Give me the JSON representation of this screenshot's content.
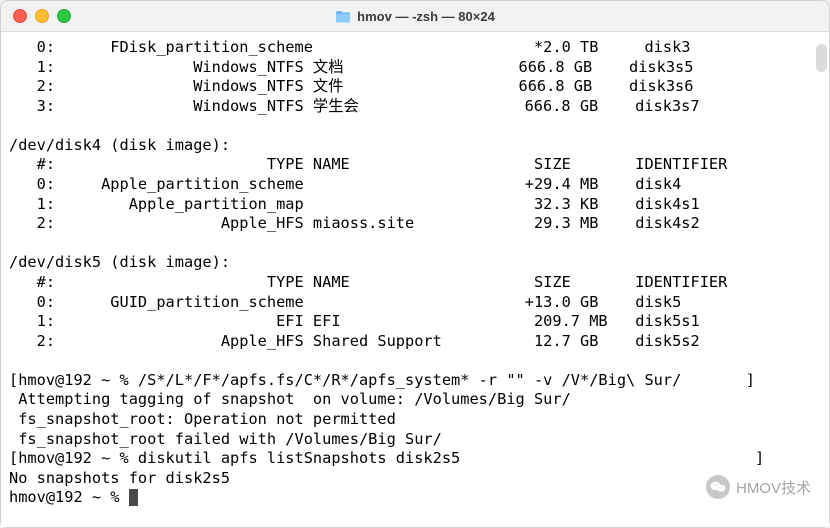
{
  "window": {
    "title": "hmov — -zsh — 80×24"
  },
  "terminal": {
    "lines": [
      "   0:      FDisk_partition_scheme                        *2.0 TB     disk3",
      "   1:               Windows_NTFS 文档                   666.8 GB    disk3s5",
      "   2:               Windows_NTFS 文件                   666.8 GB    disk3s6",
      "   3:               Windows_NTFS 学生会                  666.8 GB    disk3s7",
      "",
      "/dev/disk4 (disk image):",
      "   #:                       TYPE NAME                    SIZE       IDENTIFIER",
      "   0:     Apple_partition_scheme                        +29.4 MB    disk4",
      "   1:        Apple_partition_map                         32.3 KB    disk4s1",
      "   2:                  Apple_HFS miaoss.site             29.3 MB    disk4s2",
      "",
      "/dev/disk5 (disk image):",
      "   #:                       TYPE NAME                    SIZE       IDENTIFIER",
      "   0:      GUID_partition_scheme                        +13.0 GB    disk5",
      "   1:                        EFI EFI                     209.7 MB   disk5s1",
      "   2:                  Apple_HFS Shared Support          12.7 GB    disk5s2",
      "",
      "[hmov@192 ~ % /S*/L*/F*/apfs.fs/C*/R*/apfs_system* -r \"\" -v /V*/Big\\ Sur/       ]",
      " Attempting tagging of snapshot  on volume: /Volumes/Big Sur/",
      " fs_snapshot_root: Operation not permitted",
      " fs_snapshot_root failed with /Volumes/Big Sur/",
      "[hmov@192 ~ % diskutil apfs listSnapshots disk2s5                                ]",
      "No snapshots for disk2s5"
    ],
    "prompt": "hmov@192 ~ % "
  },
  "watermark": {
    "text": "HMOV技术"
  }
}
